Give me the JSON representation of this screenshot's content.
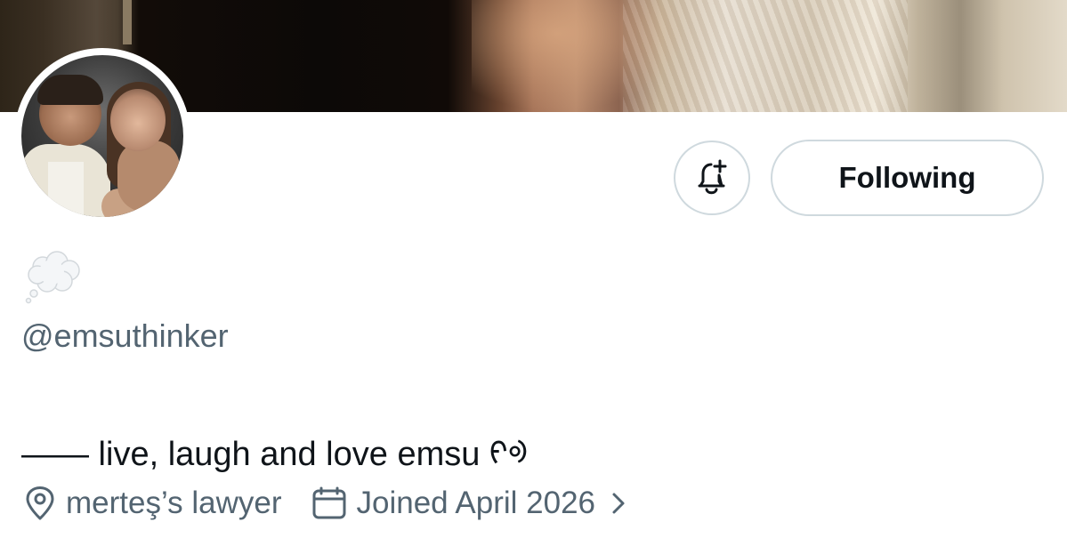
{
  "profile": {
    "display_name_emoji": "💭",
    "handle": "@emsuthinker",
    "bio": "—— live, laugh and love emsu ᠻᢀ",
    "location": "merteş’s lawyer",
    "joined": "Joined April 2026"
  },
  "actions": {
    "follow_label": "Following",
    "notify_icon": "bell-plus-icon"
  },
  "icons": {
    "location": "location-pin-icon",
    "calendar": "calendar-icon",
    "chevron": "chevron-right-icon"
  },
  "colors": {
    "text_primary": "#0f1419",
    "text_secondary": "#536471",
    "button_border": "#cfd9de"
  }
}
